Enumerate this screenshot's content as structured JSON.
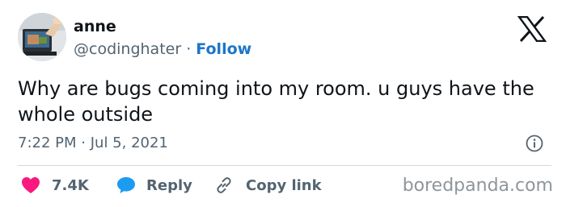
{
  "author": {
    "name": "anne",
    "handle": "@codinghater",
    "separator": "·",
    "follow_label": "Follow"
  },
  "tweet": {
    "text": "Why are bugs coming into my room. u guys have the whole outside",
    "time": "7:22 PM",
    "date": "Jul 5, 2021",
    "separator": "·"
  },
  "actions": {
    "like_count": "7.4K",
    "reply_label": "Reply",
    "copy_label": "Copy link"
  },
  "icons": {
    "logo": "x-logo-icon",
    "info": "info-icon",
    "like": "heart-icon",
    "reply": "speech-bubble-icon",
    "copy": "link-icon"
  },
  "colors": {
    "text": "#0f1419",
    "muted": "#536471",
    "follow": "#1d75c9",
    "heart": "#f91880",
    "reply": "#1d9bf0",
    "divider": "#cfd9de"
  },
  "watermark": "boredpanda.com"
}
